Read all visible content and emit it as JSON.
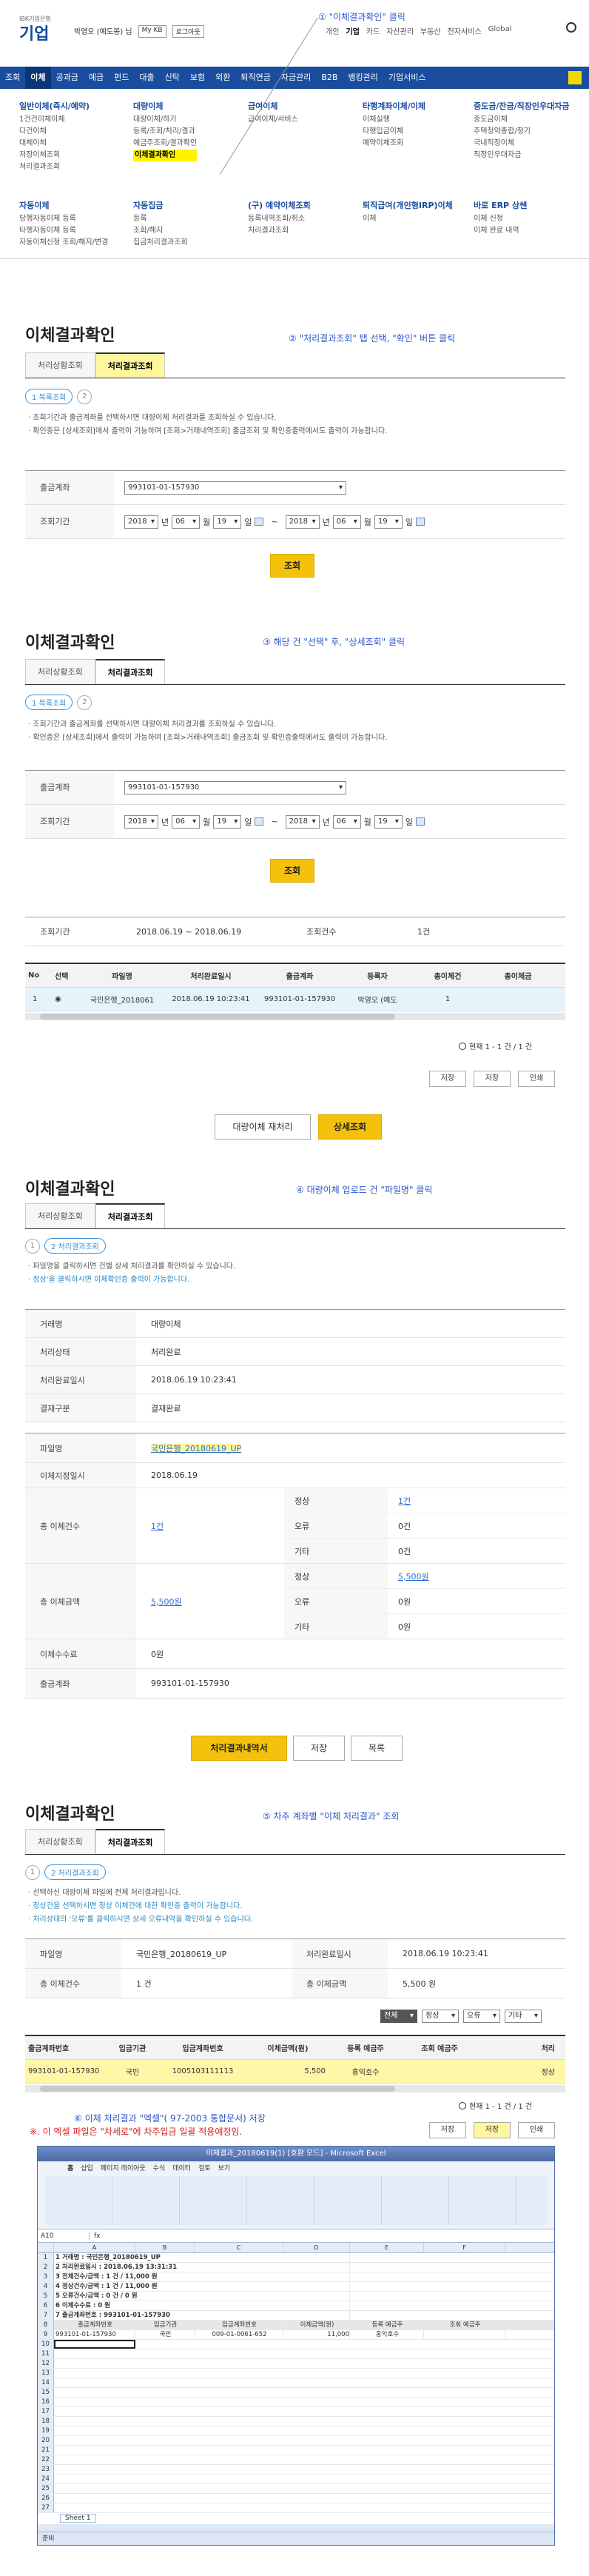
{
  "header": {
    "brand_small": "IBK기업은행",
    "brand": "기업",
    "user": "박영오 (예도봉) 님",
    "mykb": "My KB",
    "logout": "로그아웃",
    "right": [
      "개인",
      "기업",
      "카드",
      "자산관리",
      "부동산",
      "전자서비스",
      "Global"
    ],
    "menu": [
      "조회",
      "이체",
      "공과금",
      "예금",
      "펀드",
      "대출",
      "신탁",
      "보험",
      "외환",
      "퇴직연금",
      "자금관리",
      "B2B",
      "뱅킹관리",
      "기업서비스"
    ]
  },
  "mega": {
    "c1": {
      "title": "일반이체(즉시/예약)",
      "items": [
        "1건건이체이체",
        "다건이체",
        "대체이체",
        "저장이체조회",
        "처리결과조회"
      ]
    },
    "c2": {
      "title": "대량이체",
      "items": [
        "대량이체/하기",
        "등록/조회/처리/결과",
        "예금주조회/결과확인",
        "이체결과확인"
      ]
    },
    "c3": {
      "title": "급여이체",
      "items": [
        "급여이체/서비스"
      ]
    },
    "c4": {
      "title": "타행계좌이체/이체",
      "items": [
        "이체실행",
        "타행입금이체",
        "예약이체조회"
      ]
    },
    "c5": {
      "title": "중도금/잔금/직장인우대자금",
      "items": [
        "중도금이체",
        "주택청약종합/정기",
        "국내직장이체",
        "직장인우대자금"
      ]
    },
    "c6": {
      "title": "자동이체",
      "items": [
        "당행자동이체 등록",
        "타행자동이체 등록",
        "자동이체신청 조회/해지/변경"
      ]
    },
    "c7": {
      "title": "자동집금",
      "items": [
        "등록",
        "조회/해지",
        "집금처리결과조회"
      ]
    },
    "c8": {
      "title": "(구) 예약이체조회",
      "items": [
        "등록내역조회/취소",
        "처리결과조회"
      ]
    },
    "c9": {
      "title": "퇴직급여(개인형IRP)이체",
      "items": [
        "이체"
      ]
    },
    "c10": {
      "title": "바로 ERP 상쌘",
      "items": [
        "이체 신청",
        "이체 완료 내역"
      ]
    }
  },
  "notes": {
    "n1": "① \"이체결과확인\" 클릭",
    "n2": "② \"처리결과조회\" 탭 선택, \"확인\" 버튼 클릭",
    "n3": "③ 해당 건 \"선택\" 후, \"상세조회\" 클릭",
    "n4": "④ 대량이체 업로드 건 \"파일명\" 클릭",
    "n5": "⑤ 차주 계좌별 \"이체 처리결과\" 조회",
    "n6": "⑥ 이체 처리결과 \"엑셀\"( 97-2003 통합문서) 저장",
    "n6b": "※. 이 엑셀 파일은 \"차세로\"에 차주입금 일괄 적용예정임."
  },
  "s1": {
    "title": "이체결과확인",
    "tab1": "처리상황조회",
    "tab2": "처리결과조회",
    "step1": "1 목록조회",
    "step2": "2",
    "bullets": [
      "· 조회기간과 출금계좌를 선택하시면 대량이체 처리결과를 조회하실 수 있습니다.",
      "· 확인증은 [상세조회]에서 출력이 가능하며 [조회>거래내역조회] 출금조회 및 확인증출력에서도 출력이 가능합니다."
    ],
    "account_label": "출금계좌",
    "account": "993101-01-157930",
    "period_label": "조회기간",
    "y1": "2018",
    "m1": "06",
    "d1": "19",
    "y2": "2018",
    "m2": "06",
    "d2": "19",
    "yr": "년",
    "mo": "월",
    "dy": "일",
    "tilde": "~",
    "search": "조회"
  },
  "s2": {
    "title": "이체결과확인",
    "tab1": "처리상황조회",
    "tab2": "처리결과조회",
    "step1": "1 목록조회",
    "step2": "2",
    "bullets": [
      "· 조회기간과 출금계좌를 선택하시면 대량이체 처리결과를 조회하실 수 있습니다.",
      "· 확인증은 [상세조회]에서 출력이 가능하며 [조회>거래내역조회] 출금조회 및 확인증출력에서도 출력이 가능합니다."
    ],
    "account_label": "출금계좌",
    "account": "993101-01-157930",
    "period_label": "조회기간",
    "y1": "2018",
    "m1": "06",
    "d1": "19",
    "y2": "2018",
    "m2": "06",
    "d2": "19",
    "search": "조회",
    "sum_period_label": "조회기간",
    "sum_period": "2018.06.19 ~ 2018.06.19",
    "sum_count_label": "조회건수",
    "sum_count": "1건",
    "cols": [
      "No",
      "선택",
      "파일명",
      "처리완료일시",
      "출금계좌",
      "등록자",
      "총이체건",
      "총이체금"
    ],
    "row": [
      "1",
      "◉",
      "국민은행_2018061",
      "2018.06.19 10:23:41",
      "993101-01-157930",
      "박영오 (예도",
      "1",
      ""
    ],
    "page": "현재 1 - 1 건 / 1 건",
    "save1": "저장",
    "save2": "저장",
    "print": "인쇄",
    "btn_reprocess": "대량이체 재처리",
    "btn_detail": "상세조회"
  },
  "s3": {
    "title": "이체결과확인",
    "tab1": "처리상황조회",
    "tab2": "처리결과조회",
    "step1": "1",
    "step2": "2 처리결과조회",
    "bullets": [
      "· 파일명을 클릭하시면 건별 상세 처리결과를 확인하실 수 있습니다.",
      "· 정상'을 클릭하시면 이체확인증 출력이 가능합니다."
    ],
    "rows": [
      [
        "거래명",
        "대량이체"
      ],
      [
        "처리상태",
        "처리완료"
      ],
      [
        "처리완료일시",
        "2018.06.19 10:23:41"
      ],
      [
        "결재구분",
        "결재완료"
      ]
    ],
    "file_label": "파일명",
    "file": "국민은행_20180619_UP",
    "date_label": "이체지정일시",
    "date": "2018.06.19",
    "cnt_label": "총 이체건수",
    "cnt": "1건",
    "n_ok": "정상",
    "n_ok_v": "1건",
    "n_err": "오류",
    "n_err_v": "0건",
    "n_etc": "기타",
    "n_etc_v": "0건",
    "amt_label": "총 이체금액",
    "amt": "5,500원",
    "a_ok": "정상",
    "a_ok_v": "5,500원",
    "a_err": "오류",
    "a_err_v": "0원",
    "a_etc": "기타",
    "a_etc_v": "0원",
    "fee_label": "이체수수료",
    "fee": "0원",
    "acct_label": "출금계좌",
    "acct": "993101-01-157930",
    "btn_print": "처리결과내역서",
    "btn_save": "저장",
    "btn_list": "목록"
  },
  "s4": {
    "title": "이체결과확인",
    "tab1": "처리상황조회",
    "tab2": "처리결과조회",
    "step1": "1",
    "step2": "2 처리결과조회",
    "bullets": [
      "· 선택하신 대량이체 파일에 전체 처리결과입니다.",
      "· 정상건을 선택하시면 정상 이체건에 대한 확인증 출력이 가능합니다.",
      "· 처리상태의 '오류'를 클릭하시면 상세 오류내역을 확인하실 수 있습니다."
    ],
    "file_label": "파일명",
    "file": "국민은행_20180619_UP",
    "done_label": "처리완료일시",
    "done": "2018.06.19 10:23:41",
    "cnt_label": "총 이체건수",
    "cnt": "1 건",
    "amt_label": "총 이체금액",
    "amt": "5,500 원",
    "filters": [
      "전체",
      "정상",
      "오류",
      "기타"
    ],
    "cols": [
      "출금계좌번호",
      "입금기관",
      "입금계좌번호",
      "이체금액(원)",
      "등록 예금주",
      "조회 예금주",
      "처리"
    ],
    "row": [
      "993101-01-157930",
      "국민",
      "1005103111113",
      "5,500",
      "홍익호수",
      "",
      "정상"
    ],
    "page": "현재 1 - 1 건 / 1 건",
    "save1": "저장",
    "save2": "저장",
    "print": "인쇄"
  },
  "excel": {
    "title": "이체결과_20180619(1) [호환 모드] - Microsoft Excel",
    "tabs": [
      "홈",
      "삽입",
      "페이지 레이아웃",
      "수식",
      "데이터",
      "검토",
      "보기"
    ],
    "cell": "A10",
    "lines": [
      "1 거래명 : 국민은행_20180619_UP",
      "2 처리완료일시 : 2018.06.19 13:31:31",
      "3 전체건수/금액 : 1 건 / 11,000 원",
      "4 정상건수/금액 : 1 건 / 11,000 원",
      "5 오류건수/금액 : 0 건 / 0 원",
      "6 이체수수료 : 0 원",
      "7 출금계좌번호 : 993101-01-157930"
    ],
    "hcols": [
      "출금계좌번호",
      "입금기관",
      "입금계좌번호",
      "이체금액(원)",
      "등록 예금주",
      "조회 예금주"
    ],
    "drow": [
      "993101-01-157930",
      "국민",
      "009-01-0061-652",
      "11,000",
      "홍익호수",
      ""
    ],
    "sheet": "Sheet 1",
    "status": "준비"
  }
}
